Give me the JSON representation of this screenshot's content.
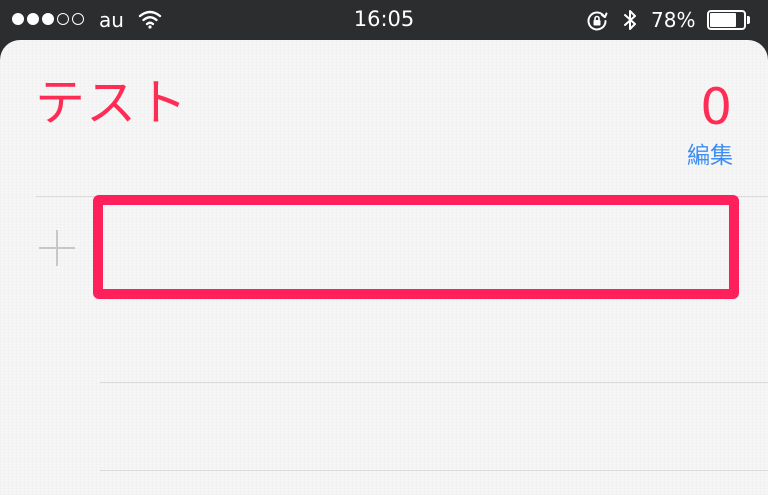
{
  "status_bar": {
    "signal_strength": 3,
    "signal_max": 5,
    "carrier": "au",
    "wifi_icon": "wifi-icon",
    "time": "16:05",
    "orientation_lock_icon": "orientation-lock-icon",
    "bluetooth_icon": "bluetooth-icon",
    "battery_percent_label": "78%",
    "battery_level": 0.78
  },
  "list": {
    "title": "テスト",
    "count": "0",
    "edit_label": "編集",
    "add_icon": "plus-icon",
    "new_item_value": ""
  },
  "colors": {
    "accent": "#ff2d55",
    "link": "#3d8ef0",
    "highlight_box": "#ff1f5a"
  }
}
